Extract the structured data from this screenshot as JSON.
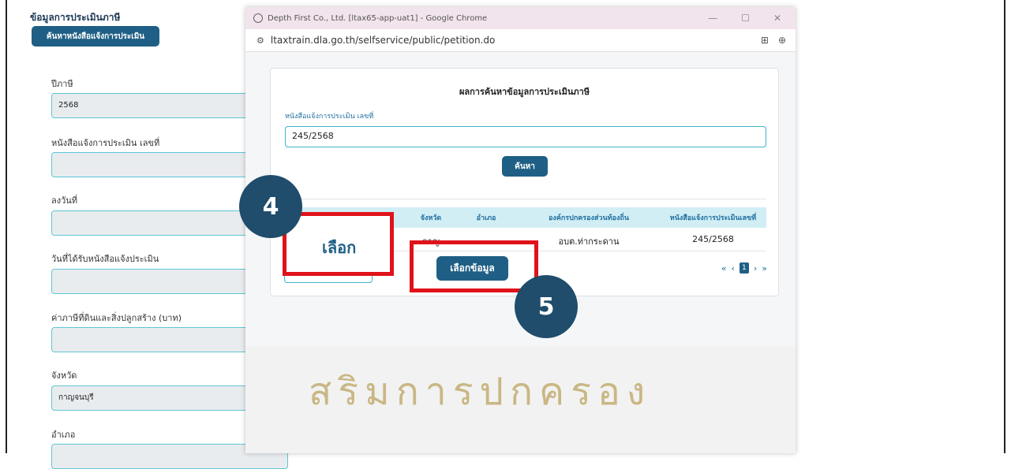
{
  "left_form": {
    "section_title": "ข้อมูลการประเมินภาษี",
    "search_button": "ค้นหาหนังสือแจ้งการประเมิน",
    "fields": [
      {
        "label": "ปีภาษี",
        "value": "2568"
      },
      {
        "label": "หนังสือแจ้งการประเมิน เลขที่",
        "value": ""
      },
      {
        "label": "ลงวันที่",
        "value": ""
      },
      {
        "label": "วันที่ได้รับหนังสือแจ้งประเมิน",
        "value": ""
      },
      {
        "label": "ค่าภาษีที่ดินและสิ่งปลูกสร้าง (บาท)",
        "value": ""
      },
      {
        "label": "จังหวัด",
        "value": "กาญจนบุรี"
      },
      {
        "label": "อำเภอ",
        "value": ""
      }
    ]
  },
  "popup": {
    "window_title": "Depth First Co., Ltd. [ltax65-app-uat1] - Google Chrome",
    "url": "ltaxtrain.dla.go.th/selfservice/public/petition.do",
    "card_title": "ผลการค้นหาข้อมูลการประเมินภาษี",
    "notice_label": "หนังสือแจ้งการประเมิน เลขที่",
    "notice_value": "245/2568",
    "search_button": "ค้นหา",
    "table": {
      "headers": [
        "จังหวัด",
        "อำเภอ",
        "องค์กรปกครองส่วนท้องถิ่น",
        "หนังสือแจ้งการประเมินเลขที่"
      ],
      "rows": [
        [
          "กาญ",
          "",
          "อบต.ท่ากระดาน",
          "245/2568"
        ]
      ]
    },
    "pager": {
      "first": "«",
      "prev": "‹",
      "current": "1",
      "next": "›",
      "last": "»"
    },
    "seal_text": "สริมการปกครอง"
  },
  "annotations": {
    "step4_number": "4",
    "step4_label": "เลือก",
    "step5_number": "5",
    "step5_button": "เลือกข้อมูล"
  }
}
